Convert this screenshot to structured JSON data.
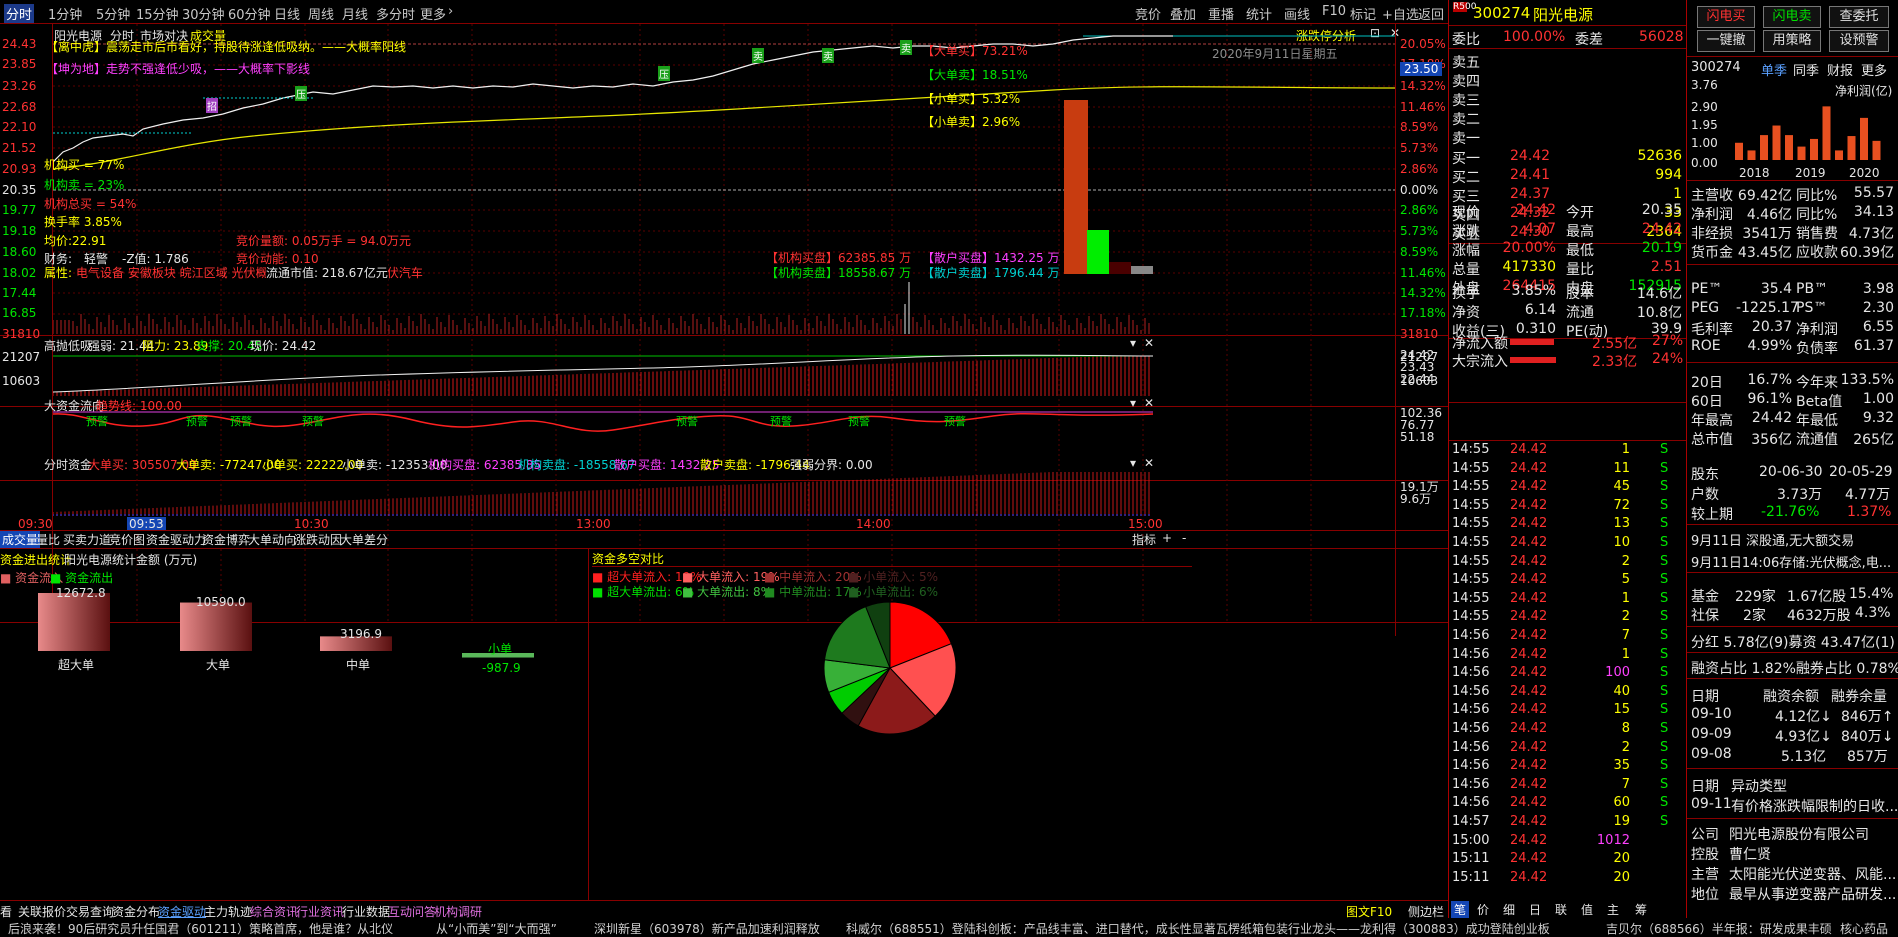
{
  "topbar": {
    "tabs": [
      "分时",
      "1分钟",
      "5分钟",
      "15分钟",
      "30分钟",
      "60分钟",
      "日线",
      "周线",
      "月线",
      "多分时",
      "更多"
    ],
    "tools": [
      "竞价",
      "叠加",
      "重播",
      "统计",
      "画线",
      "F10",
      "标记",
      "+自选",
      "返回"
    ]
  },
  "chart_header": {
    "name": "阳光电源",
    "mode": "分时",
    "market": "市场对决",
    "vol_label": "成交量",
    "right_label": "涨跌停分析",
    "date": "2020年9月11日星期五"
  },
  "left_axis": [
    "24.43",
    "23.85",
    "23.26",
    "22.68",
    "22.10",
    "21.52",
    "20.93",
    "20.35",
    "19.77",
    "19.18",
    "18.60",
    "18.02",
    "17.44",
    "16.85"
  ],
  "right_axis": [
    "20.05%",
    "17.18%",
    "14.32%",
    "11.46%",
    "8.59%",
    "5.73%",
    "2.86%",
    "0.00%",
    "2.86%",
    "5.73%",
    "8.59%",
    "11.46%",
    "14.32%",
    "17.18%"
  ],
  "price_badge": "23.50",
  "vol_axis": [
    "31810",
    "21207",
    "10603"
  ],
  "annotations": {
    "center": "【离中虎】震荡走市后市看好，持股待涨逢低吸纳。——大概率阳线",
    "kun": "【坤为地】走势不强逢低少吸，——大概率下影线",
    "jg_buy": "机构买 = 77%",
    "jg_sell": "机构卖 = 23%",
    "jg_total": "机构总买 = 54%",
    "turnover": "换手率 3.85%",
    "avg": "均价:22.91",
    "finance": "财务:",
    "finance_val": "轻警",
    "z": "-Z值: 1.786",
    "attr": "属性:",
    "attr_val": "电气设备 安徽板块 皖江区域 光伏概念 阿里概念 深股通 光伏汽车",
    "float": "流通市值: 218.67亿元",
    "big_order": "竞价量额: 0.05万手 = 94.0万元",
    "auction": "竞价动能: 0.10",
    "inst_buy": "【机构买盘】62385.85 万",
    "retail_buy": "【散户买盘】1432.25 万",
    "inst_sell": "【机构卖盘】18558.67 万",
    "retail_sell": "【散户卖盘】1796.44 万",
    "big_sell_pct": "【大单买】73.21%",
    "big_buy": "【大单卖】18.51%",
    "small_buy": "【小单买】5.32%",
    "small_sell": "【小单卖】2.96%"
  },
  "sub1": {
    "title": "高抛低吸",
    "strong": "强弱: 21.44",
    "resist": "阻力: 23.89",
    "support": "支撑: 20.45",
    "now": "现价: 24.42",
    "axis": [
      "24.42",
      "23.43",
      "22.44"
    ]
  },
  "sub2": {
    "title": "大资金流向",
    "trend": "趋势线: 100.00",
    "axis": [
      "102.36",
      "76.77",
      "51.18"
    ],
    "warn": "预警"
  },
  "sub3": {
    "title": "分时资金",
    "items": [
      "大单买: 305507.00",
      "大单卖: -77247.00",
      "小单买: 22222.00",
      "小单卖: -12353.00",
      "机构买盘: 62385.85",
      "机构卖盘: -18558.67",
      "散户买盘: 1432.25",
      "散户卖盘: -1796.44",
      "强弱分界: 0.00"
    ],
    "axis": [
      "19.1万",
      "9.6万"
    ]
  },
  "time_axis": [
    "09:30",
    "09:53",
    "10:30",
    "13:00",
    "14:00",
    "15:00"
  ],
  "bottom_tabs": [
    "成交量",
    "量比",
    "买卖力道",
    "竞价图",
    "资金驱动力",
    "资金博弈",
    "大单动向",
    "涨跌动因",
    "大单差分"
  ],
  "bottom_right": [
    "指标",
    "+",
    "-"
  ],
  "fund_stats": {
    "title": "资金进出统计",
    "stock": "阳光电源",
    "unit": "统计金额 (万元)",
    "legend_in": "资金流入",
    "legend_out": "资金流出",
    "bars": [
      {
        "label": "超大单",
        "value": "12672.8"
      },
      {
        "label": "大单",
        "value": "10590.0"
      },
      {
        "label": "中单",
        "value": "3196.9"
      },
      {
        "label": "小单",
        "value": "-987.9"
      }
    ]
  },
  "pie": {
    "title": "资金多空对比",
    "legend": [
      "超大单流入: 19%",
      "大单流入: 19%",
      "中单流入: 20%",
      "小单流入: 5%",
      "超大单流出: 6%",
      "大单流出: 8%",
      "中单流出: 17%",
      "小单流出: 6%"
    ],
    "values": [
      19,
      19,
      20,
      5,
      6,
      8,
      17,
      6
    ],
    "colors": [
      "#ff0000",
      "#ff5050",
      "#8c1a1a",
      "#301010",
      "#00cc00",
      "#38b038",
      "#1e7a1e",
      "#104010"
    ]
  },
  "left_tabs": [
    "关联报价",
    "交易查询",
    "资金分布",
    "资金驱动",
    "主力轨迹",
    "综合资讯",
    "行业资讯",
    "行业数据",
    "互动问答",
    "机构调研"
  ],
  "left_tab0": "看",
  "right_bottom_tabs": [
    "图文F10",
    "侧边栏",
    "笔",
    "价",
    "细",
    "日",
    "联",
    "值",
    "主",
    "筹"
  ],
  "news": [
    "后浪来袭！90后研究员升任国君（601211）策略首席，他是谁？从北仪",
    "从“小而美”到“大而强”",
    "深圳新星（603978）新产品加速利润释放",
    "科威尔（688551）登陆科创板：产品线丰富、进口替代，成长性显著",
    "瓦楞纸箱包装行业龙头——龙利得（300883）成功登陆创业板",
    "吉贝尔（688566）半年报：研发成果丰硕",
    "核心药品"
  ],
  "quote": {
    "code": "300274",
    "name": "阳光电源",
    "rank_badge": "R500",
    "weibi_label": "委比",
    "weibi": "100.00%",
    "weicha_label": "委差",
    "weicha": "56028",
    "asks": [
      {
        "l": "卖五"
      },
      {
        "l": "卖四"
      },
      {
        "l": "卖三"
      },
      {
        "l": "卖二"
      },
      {
        "l": "卖一"
      }
    ],
    "bids": [
      {
        "l": "买一",
        "p": "24.42",
        "v": "52636"
      },
      {
        "l": "买二",
        "p": "24.41",
        "v": "994"
      },
      {
        "l": "买三",
        "p": "24.37",
        "v": "1"
      },
      {
        "l": "买四",
        "p": "24.32",
        "v": "33"
      },
      {
        "l": "买五",
        "p": "24.30",
        "v": "2364"
      }
    ],
    "stats": [
      [
        "现价",
        "24.42",
        "今开",
        "20.35"
      ],
      [
        "涨跌",
        "4.07",
        "最高",
        "24.42"
      ],
      [
        "涨幅",
        "20.00%",
        "最低",
        "20.19"
      ],
      [
        "总量",
        "417330",
        "量比",
        "2.51"
      ],
      [
        "外盘",
        "264415",
        "内盘",
        "152915"
      ]
    ],
    "stats2": [
      [
        "换手",
        "3.85%",
        "股本",
        "14.6亿"
      ],
      [
        "净资",
        "6.14",
        "流通",
        "10.8亿"
      ],
      [
        "收益(三)",
        "0.310",
        "PE(动)",
        "39.9"
      ]
    ],
    "flow": [
      [
        "净流入额",
        "2.55亿",
        "27%"
      ],
      [
        "大宗流入",
        "2.33亿",
        "24%"
      ]
    ]
  },
  "ticks": [
    [
      "14:55",
      "24.42",
      "1",
      "S"
    ],
    [
      "14:55",
      "24.42",
      "11",
      "S"
    ],
    [
      "14:55",
      "24.42",
      "45",
      "S"
    ],
    [
      "14:55",
      "24.42",
      "72",
      "S"
    ],
    [
      "14:55",
      "24.42",
      "13",
      "S"
    ],
    [
      "14:55",
      "24.42",
      "10",
      "S"
    ],
    [
      "14:55",
      "24.42",
      "2",
      "S"
    ],
    [
      "14:55",
      "24.42",
      "5",
      "S"
    ],
    [
      "14:55",
      "24.42",
      "1",
      "S"
    ],
    [
      "14:55",
      "24.42",
      "2",
      "S"
    ],
    [
      "14:56",
      "24.42",
      "7",
      "S"
    ],
    [
      "14:56",
      "24.42",
      "1",
      "S"
    ],
    [
      "14:56",
      "24.42",
      "100",
      "S"
    ],
    [
      "14:56",
      "24.42",
      "40",
      "S"
    ],
    [
      "14:56",
      "24.42",
      "15",
      "S"
    ],
    [
      "14:56",
      "24.42",
      "8",
      "S"
    ],
    [
      "14:56",
      "24.42",
      "2",
      "S"
    ],
    [
      "14:56",
      "24.42",
      "35",
      "S"
    ],
    [
      "14:56",
      "24.42",
      "7",
      "S"
    ],
    [
      "14:56",
      "24.42",
      "60",
      "S"
    ],
    [
      "14:57",
      "24.42",
      "19",
      "S"
    ],
    [
      "15:00",
      "24.42",
      "1012",
      ""
    ],
    [
      "15:11",
      "24.42",
      "20",
      ""
    ],
    [
      "15:11",
      "24.42",
      "20",
      ""
    ]
  ],
  "right_panel": {
    "buttons": [
      "闪电买",
      "闪电卖",
      "查委托",
      "一键撤",
      "用策略",
      "设预警"
    ],
    "code": "300274",
    "tabs": [
      "单季",
      "同季",
      "财报",
      "更多"
    ],
    "chart_label": "净利润(亿)",
    "y": [
      "3.76",
      "2.90",
      "1.95",
      "1.00",
      "0.00"
    ],
    "years": [
      "2018",
      "2019",
      "2020"
    ],
    "bars": [
      0.9,
      0.5,
      1.3,
      1.8,
      1.3,
      0.7,
      1.1,
      2.8,
      0.5,
      1.25,
      2.2,
      1.0
    ],
    "fin": [
      [
        "主营收",
        "69.42亿",
        "同比%",
        "55.57"
      ],
      [
        "净利润",
        "4.46亿",
        "同比%",
        "34.13"
      ],
      [
        "非经损",
        "3541万",
        "销售费",
        "4.73亿"
      ],
      [
        "货币金",
        "43.45亿",
        "应收款",
        "60.39亿"
      ]
    ],
    "val": [
      [
        "PE™",
        "35.4",
        "PB™",
        "3.98"
      ],
      [
        "PEG",
        "-1225.17",
        "PS™",
        "2.30"
      ],
      [
        "毛利率",
        "20.37",
        "净利润",
        "6.55"
      ],
      [
        "ROE",
        "4.99%",
        "负债率",
        "61.37"
      ]
    ],
    "perf": [
      [
        "20日",
        "16.7%",
        "今年来",
        "133.5%"
      ],
      [
        "60日",
        "96.1%",
        "Beta值",
        "1.00"
      ],
      [
        "年最高",
        "24.42",
        "年最低",
        "9.32"
      ],
      [
        "总市值",
        "356亿",
        "流通值",
        "265亿"
      ]
    ],
    "holders": {
      "label": "股东",
      "d1": "20-06-30",
      "d2": "20-05-29",
      "h_label": "户数",
      "h1": "3.73万",
      "h2": "4.77万",
      "c_label": "较上期",
      "c1": "-21.76%",
      "c2": "1.37%"
    },
    "news1": "9月11日 深股通,无大额交易",
    "news2": "9月11日14:06存储:光伏概念,电...",
    "funds": [
      [
        "基金",
        "229家",
        "1.67亿股",
        "15.4%"
      ],
      [
        "社保",
        "2家",
        "4632万股",
        "4.3%"
      ]
    ],
    "fin2": "分红 5.78亿(9)募资 43.47亿(1)",
    "margin": "融资占比 1.82%融券占比 0.78%",
    "margin_head": [
      "日期",
      "融资余额",
      "融券余量"
    ],
    "margin_rows": [
      [
        "09-10",
        "4.12亿↓",
        "846万↑"
      ],
      [
        "09-09",
        "4.93亿↓",
        "840万↓"
      ],
      [
        "09-08",
        "5.13亿",
        "857万"
      ]
    ],
    "abn_head": [
      "日期",
      "异动类型"
    ],
    "abn_row": [
      "09-11",
      "有价格涨跌幅限制的日收..."
    ],
    "company": [
      [
        "公司",
        "阳光电源股份有限公司"
      ],
      [
        "控股",
        "曹仁贤"
      ],
      [
        "主营",
        "太阳能光伏逆变器、风能..."
      ],
      [
        "地位",
        "最早从事逆变器产品研发..."
      ]
    ]
  }
}
